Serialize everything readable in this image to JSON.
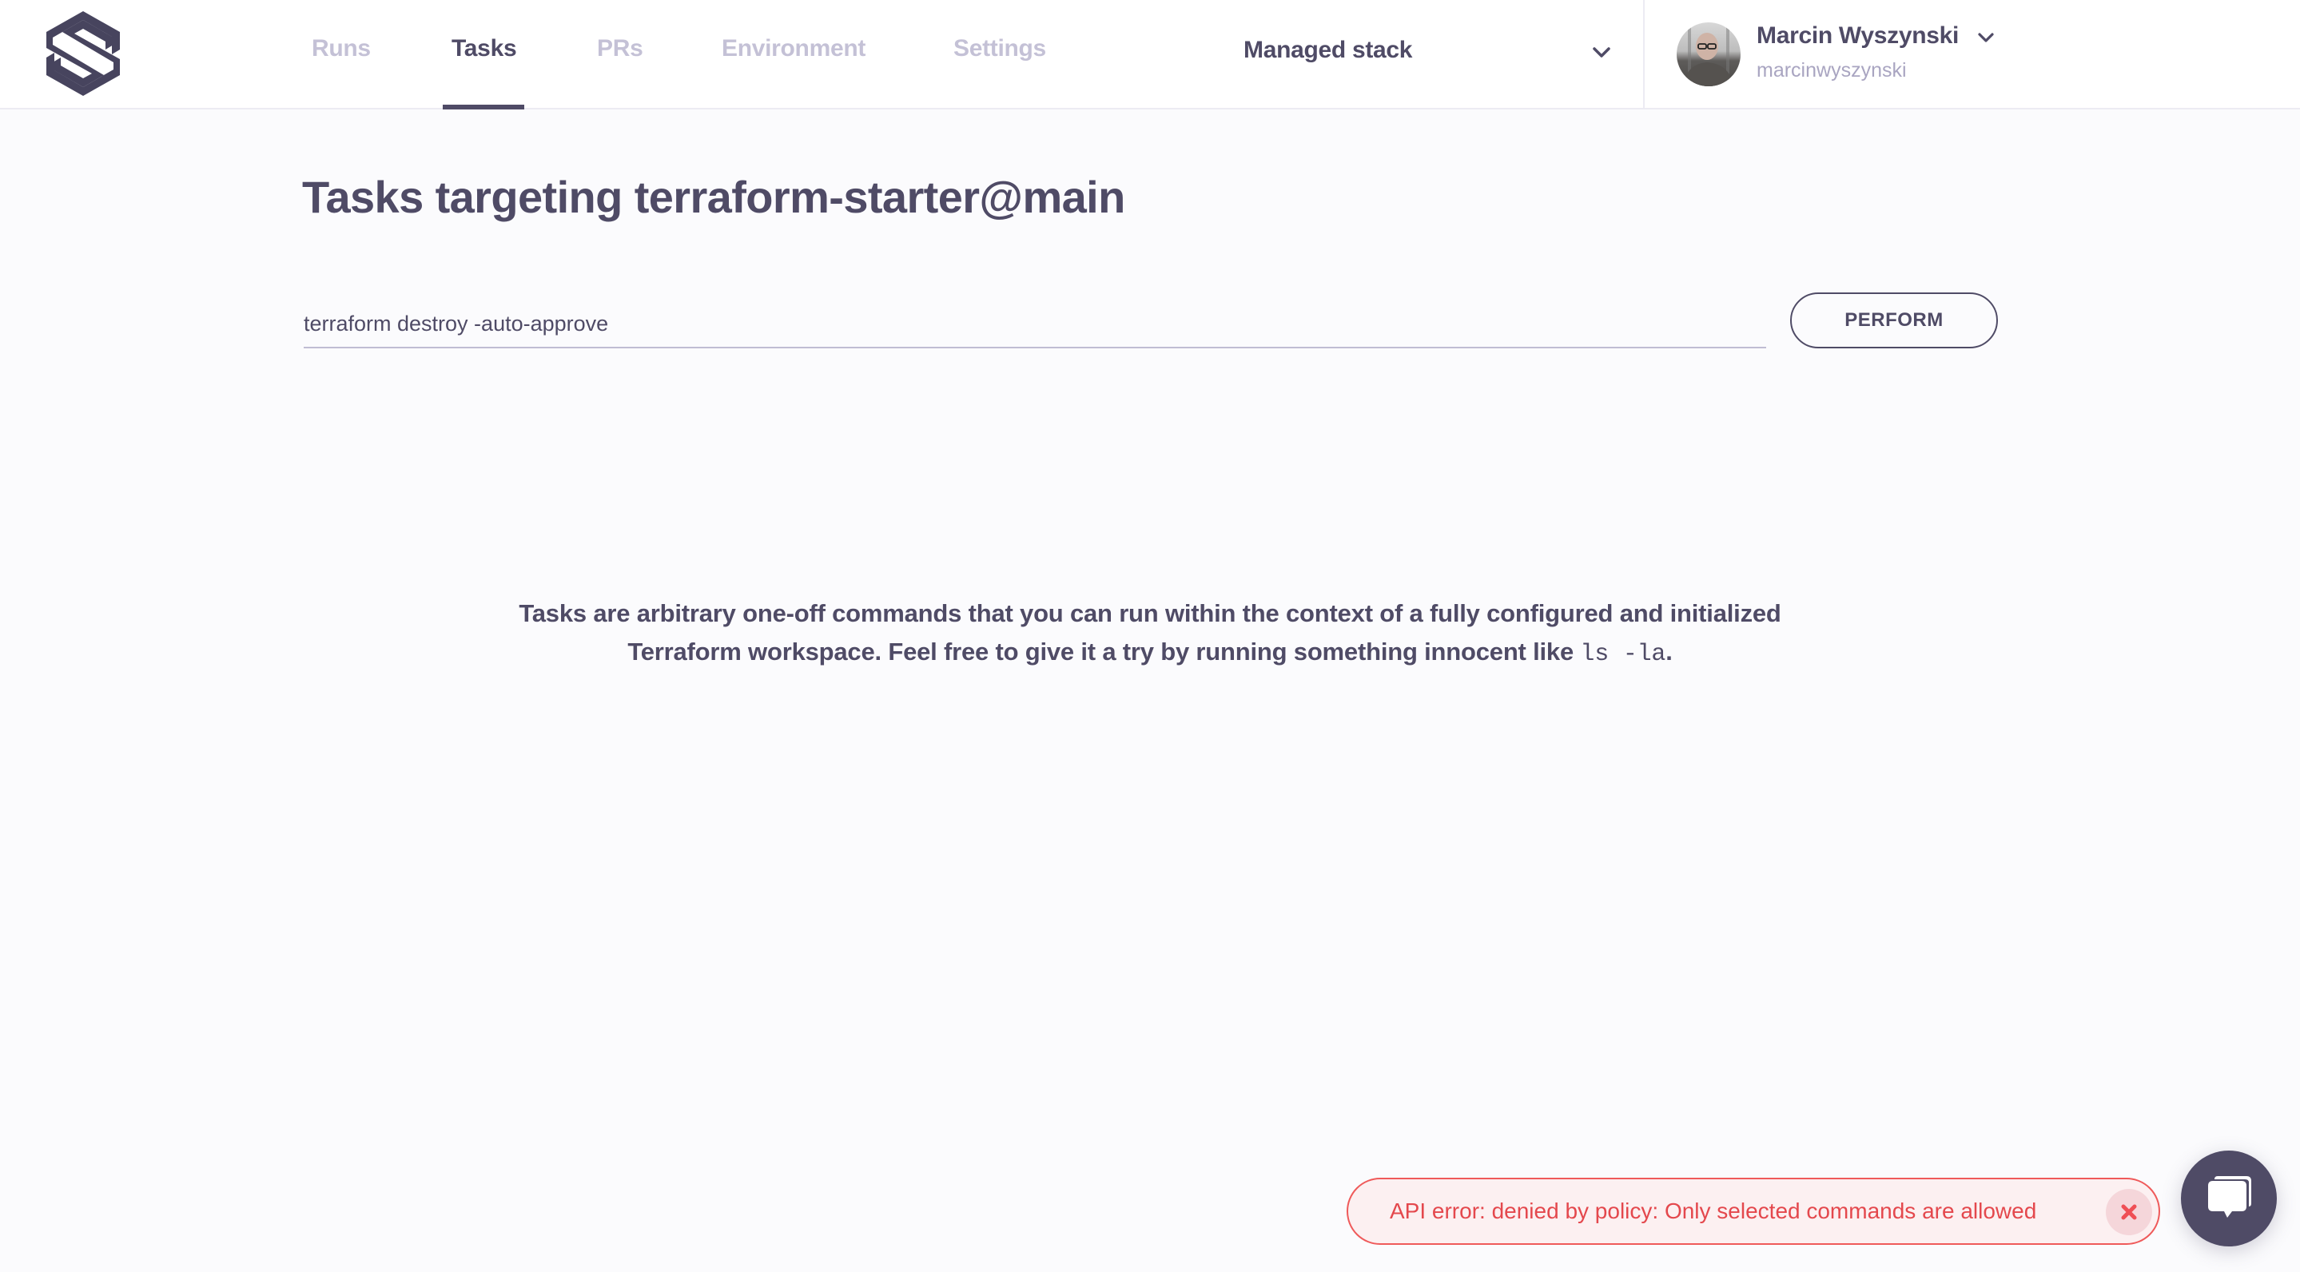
{
  "header": {
    "logo_icon": "spacelift-s-logo",
    "nav": [
      {
        "label": "Runs",
        "active": false
      },
      {
        "label": "Tasks",
        "active": true
      },
      {
        "label": "PRs",
        "active": false
      },
      {
        "label": "Environment",
        "active": false
      },
      {
        "label": "Settings",
        "active": false
      }
    ],
    "stack_selector": {
      "selected": "Managed stack",
      "icon": "chevron-down-icon"
    },
    "user": {
      "name": "Marcin Wyszynski",
      "handle": "marcinwyszynski",
      "avatar": "user-avatar-photo",
      "icon": "chevron-down-icon"
    }
  },
  "main": {
    "title": "Tasks targeting terraform-starter@main",
    "command_input": {
      "value": "terraform destroy -auto-approve",
      "placeholder": ""
    },
    "perform_label": "PERFORM",
    "description": {
      "line1": "Tasks are arbitrary one-off commands that you can run within the context of a fully configured and initialized",
      "line2_prefix": "Terraform workspace. Feel free to give it a try by running something innocent like ",
      "code": "ls -la",
      "line2_suffix": "."
    }
  },
  "toast": {
    "message": "API error: denied by policy: Only selected commands are allowed",
    "close_icon": "close-icon",
    "colors": {
      "text": "#e4484d",
      "border": "#ef5a5a",
      "background": "#fcf0f1"
    }
  },
  "chat": {
    "icon": "chat-bubbles-icon"
  },
  "colors": {
    "primary": "#4f4b66",
    "muted": "#c4c1d6",
    "background": "#fbfbfd"
  }
}
